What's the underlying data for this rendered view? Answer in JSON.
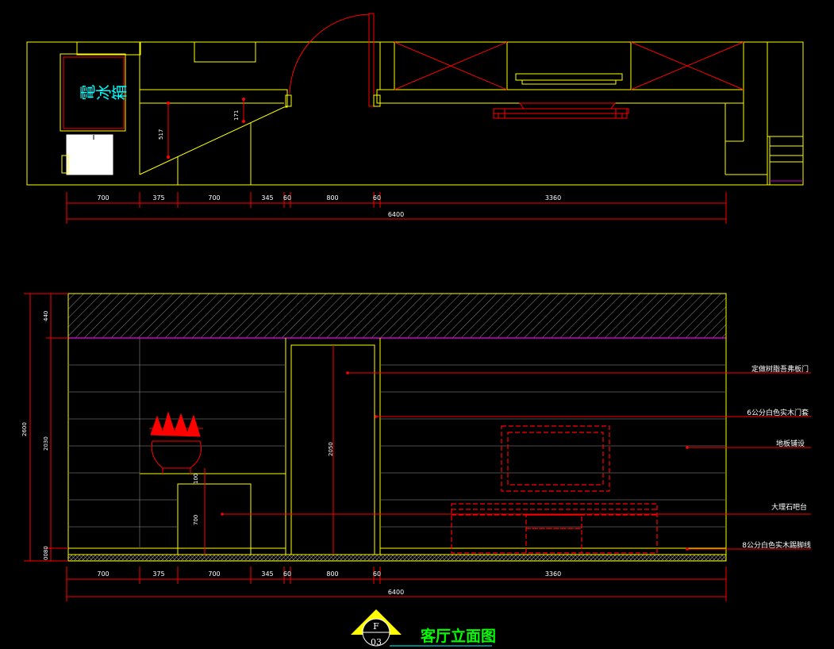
{
  "drawing": {
    "title": "客厅立面图",
    "symbol_letter": "F",
    "symbol_number": "03",
    "fridge_label": "電冰箱",
    "colors": {
      "background": "#000000",
      "outline": "#ffff00",
      "annotation": "#ff0000",
      "text": "#ffffff",
      "title": "#00ff00",
      "fridge": "#00ffff",
      "accent": "#cc00cc"
    }
  },
  "plan": {
    "dims": [
      "700",
      "375",
      "700",
      "345",
      "60",
      "800",
      "60",
      "3360"
    ],
    "total": "6400",
    "vertical_dims": [
      "517",
      "171"
    ]
  },
  "elevation": {
    "dims": [
      "700",
      "375",
      "700",
      "345",
      "60",
      "800",
      "60",
      "3360"
    ],
    "total": "6400",
    "left_dims": [
      "440",
      "2030",
      "0080"
    ],
    "left_total": "2600",
    "inner_dims": [
      "2050",
      "100",
      "700"
    ],
    "annotations": [
      "定做树脂吾弗板门",
      "6公分白色实木门套",
      "地板铺设",
      "大理石吧台",
      "8公分白色实木踢脚线"
    ]
  }
}
